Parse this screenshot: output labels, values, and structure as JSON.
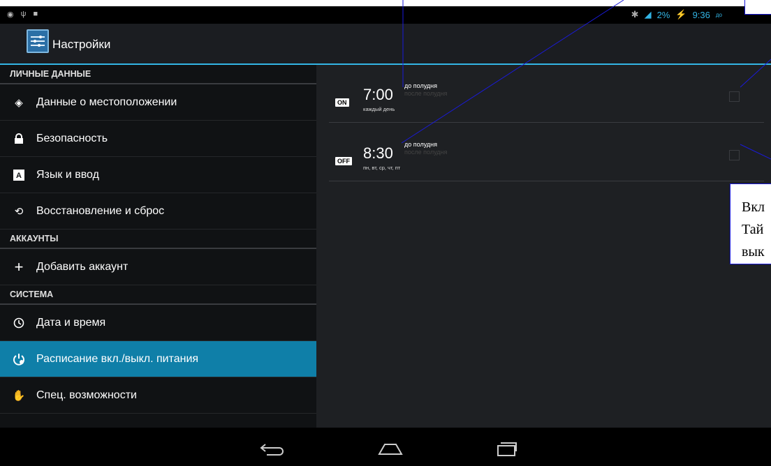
{
  "status": {
    "battery": "2%",
    "time": "9:36",
    "time_suffix": "до"
  },
  "app": {
    "title": "Настройки"
  },
  "sidebar": {
    "sections": [
      {
        "header": "ЛИЧНЫЕ ДАННЫЕ",
        "items": [
          {
            "label": "Данные о местоположении",
            "icon": "location-icon"
          },
          {
            "label": "Безопасность",
            "icon": "lock-icon"
          },
          {
            "label": "Язык и ввод",
            "icon": "keyboard-icon"
          },
          {
            "label": "Восстановление и сброс",
            "icon": "restore-icon"
          }
        ]
      },
      {
        "header": "АККАУНТЫ",
        "items": [
          {
            "label": "Добавить аккаунт",
            "icon": "plus-icon"
          }
        ]
      },
      {
        "header": "СИСТЕМА",
        "items": [
          {
            "label": "Дата и время",
            "icon": "clock-icon"
          },
          {
            "label": "Расписание вкл./выкл. питания",
            "icon": "power-schedule-icon",
            "active": true
          },
          {
            "label": "Спец. возможности",
            "icon": "hand-icon"
          }
        ]
      }
    ]
  },
  "alarms": [
    {
      "badge": "ON",
      "time": "7:00",
      "am": "до полудня",
      "pm": "после полудня",
      "days": "каждый день"
    },
    {
      "badge": "OFF",
      "time": "8:30",
      "am": "до полудня",
      "pm": "после полудня",
      "days": "пн, вт, ср, чт, пт"
    }
  ],
  "callout": {
    "lines": [
      "Вкл",
      "Тай",
      "вык"
    ]
  },
  "colors": {
    "accent": "#33b5e5",
    "active": "#0f7fa8",
    "callout_border": "#1a1adb"
  }
}
